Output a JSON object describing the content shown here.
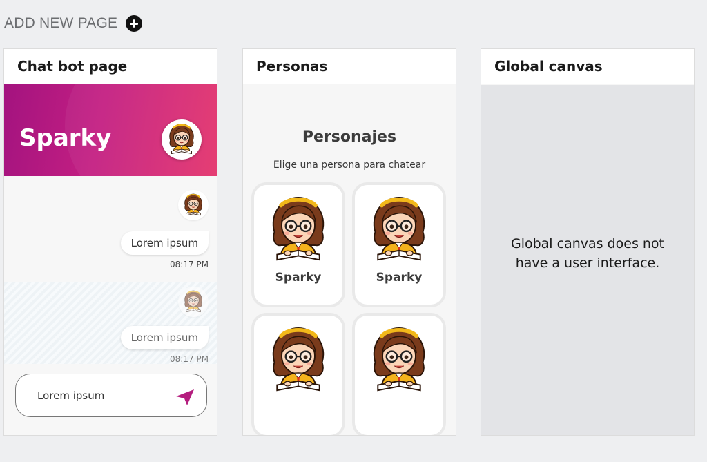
{
  "toolbar": {
    "add_new_page_label": "ADD NEW PAGE",
    "add_icon": "plus-circle-icon"
  },
  "cards": {
    "chat": {
      "title": "Chat bot page",
      "hero_title": "Sparky",
      "hero_gradient": [
        "#a3137f",
        "#e4346c"
      ],
      "messages": [
        {
          "text": "Lorem ipsum",
          "time": "08:17 PM"
        },
        {
          "text": "Lorem ipsum",
          "time": "08:17 PM"
        }
      ],
      "input_value": "Lorem ipsum",
      "send_icon": "send-arrow-icon",
      "send_color": "#b41d7e"
    },
    "personas": {
      "title": "Personas",
      "heading": "Personajes",
      "subtitle": "Elige una persona para chatear",
      "items": [
        {
          "name": "Sparky"
        },
        {
          "name": "Sparky"
        },
        {
          "name": ""
        },
        {
          "name": ""
        }
      ]
    },
    "global": {
      "title": "Global canvas",
      "message": "Global canvas does not have a user interface."
    }
  }
}
